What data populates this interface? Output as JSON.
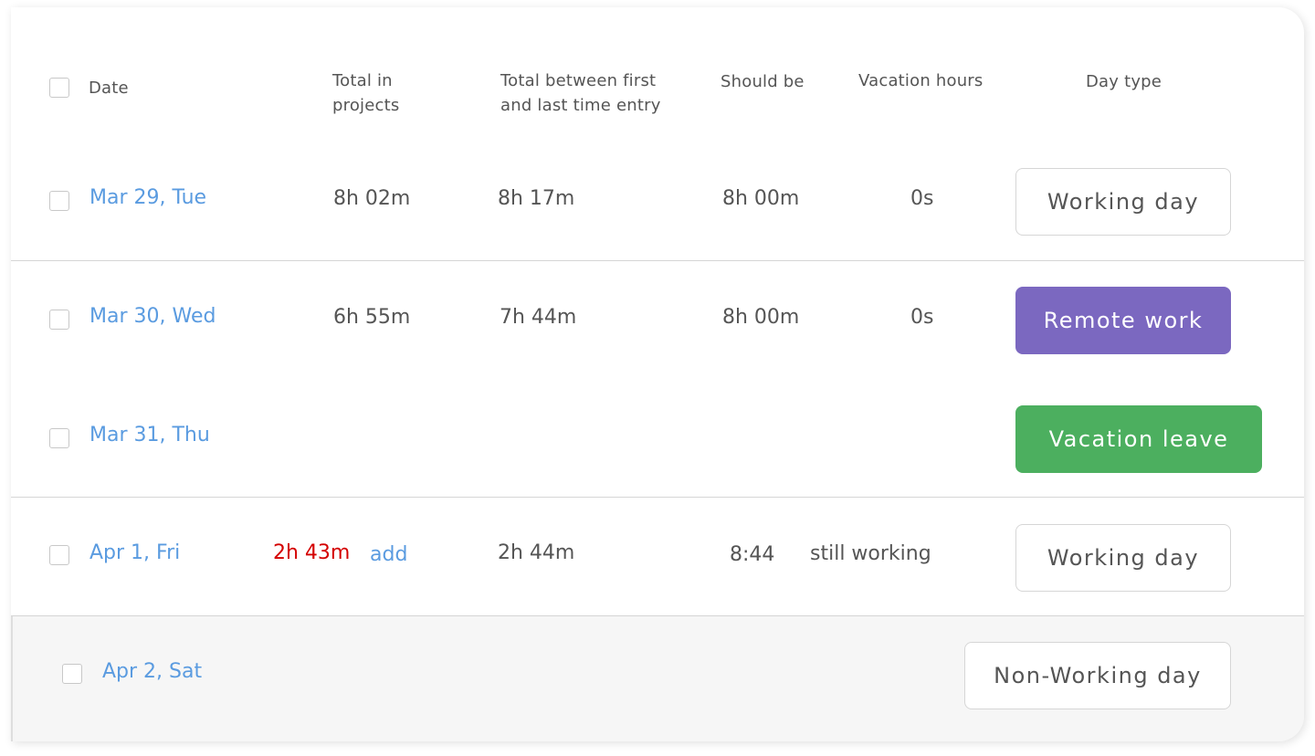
{
  "columns": {
    "date": "Date",
    "total_projects_1": "Total in",
    "total_projects_2": "projects",
    "total_between_1": "Total between first",
    "total_between_2": "and last time entry",
    "should_be": "Should be",
    "vacation_hours": "Vacation hours",
    "day_type": "Day type"
  },
  "rows": [
    {
      "date": "Mar 29, Tue",
      "total_projects": "8h 02m",
      "total_between": "8h 17m",
      "should_be": "8h 00m",
      "vacation": "0s",
      "day_type": "Working day"
    },
    {
      "date": "Mar 30, Wed",
      "total_projects": "6h 55m",
      "total_between": "7h 44m",
      "should_be": "8h 00m",
      "vacation": "0s",
      "day_type": "Remote work"
    },
    {
      "date": "Mar 31, Thu",
      "day_type": "Vacation leave"
    },
    {
      "date": "Apr 1, Fri",
      "total_projects": "2h 43m",
      "add_label": "add",
      "total_between": "2h 44m",
      "should_be": "8:44",
      "vacation": "still working",
      "day_type": "Working day"
    },
    {
      "date": "Apr 2, Sat",
      "day_type": "Non-Working day"
    }
  ],
  "colors": {
    "remote_work": "#7b68c0",
    "vacation_leave": "#4caf5f",
    "date_link": "#5a9be0",
    "alert": "#d40000"
  }
}
